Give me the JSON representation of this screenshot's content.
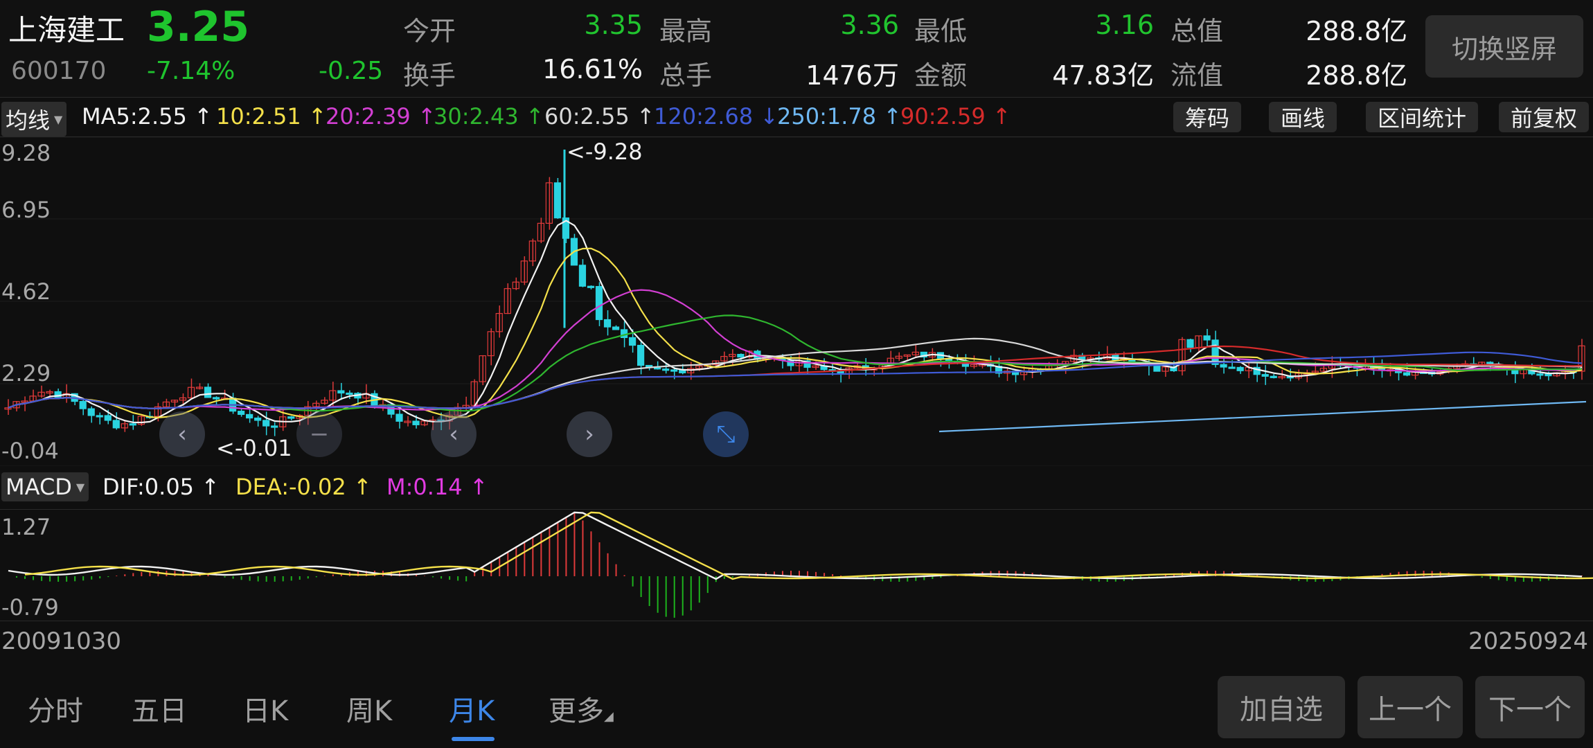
{
  "header": {
    "name": "上海建工",
    "price": "3.25",
    "code": "600170",
    "pct_change": "-7.14%",
    "change": "-0.25",
    "stats": {
      "open_label": "今开",
      "open_value": "3.35",
      "high_label": "最高",
      "high_value": "3.36",
      "low_label": "最低",
      "low_value": "3.16",
      "total_value_label": "总值",
      "total_value": "288.8亿",
      "turnover_label": "换手",
      "turnover_value": "16.61%",
      "volume_label": "总手",
      "volume_value": "1476万",
      "amount_label": "金额",
      "amount_value": "47.83亿",
      "float_value_label": "流值",
      "float_value": "288.8亿"
    },
    "switch_button": "切换竖屏"
  },
  "ma_row": {
    "dropdown": "均线",
    "items": [
      {
        "text": "MA5:2.55 ↑",
        "color": "#f2f2f2"
      },
      {
        "text": "10:2.51 ↑",
        "color": "#f4e04a"
      },
      {
        "text": "20:2.39 ↑",
        "color": "#d23fd2"
      },
      {
        "text": "30:2.43 ↑",
        "color": "#2fb62f"
      },
      {
        "text": "60:2.55 ↑",
        "color": "#d9d9d9"
      },
      {
        "text": "120:2.68 ↓",
        "color": "#3f5bd6"
      },
      {
        "text": "250:1.78 ↑",
        "color": "#6fb8f2"
      },
      {
        "text": "90:2.59 ↑",
        "color": "#d62b2b"
      }
    ],
    "tools": [
      "筹码",
      "画线",
      "区间统计",
      "前复权"
    ]
  },
  "chart": {
    "y_labels": [
      "9.28",
      "6.95",
      "4.62",
      "2.29",
      "-0.04"
    ],
    "high_marker": "<-9.28",
    "low_marker": "<-0.01"
  },
  "macd_row": {
    "dropdown": "MACD",
    "dif": "DIF:0.05 ↑",
    "dea": "DEA:-0.02 ↑",
    "m": "M:0.14 ↑",
    "y_labels": [
      "1.27",
      "-0.79"
    ]
  },
  "dates": {
    "start": "20091030",
    "end": "20250924"
  },
  "tabs": [
    "分时",
    "五日",
    "日K",
    "周K",
    "月K",
    "更多"
  ],
  "active_tab": "月K",
  "bottom_buttons": [
    "加自选",
    "上一个",
    "下一个"
  ],
  "colors": {
    "up": "#e03a3a",
    "down": "#2ad3e0",
    "price_down": "#21c42f",
    "accent": "#3d86e8"
  }
}
